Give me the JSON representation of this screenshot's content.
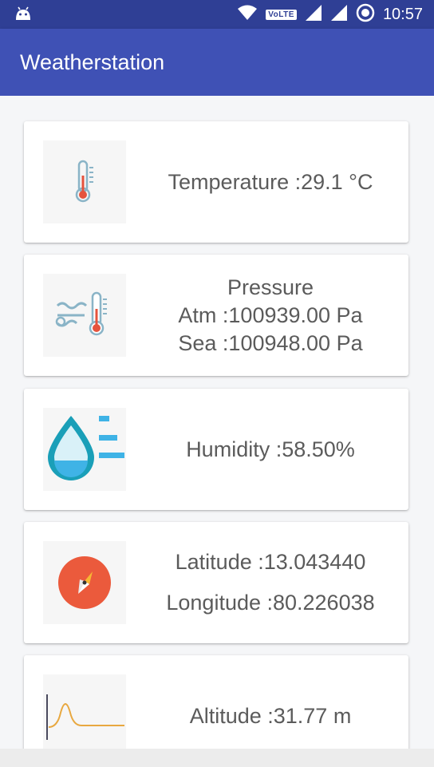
{
  "status_bar": {
    "time": "10:57",
    "network_badge": "VoLTE",
    "icons": [
      "android-icon",
      "wifi-icon",
      "signal-icon",
      "signal-icon",
      "sync-icon"
    ]
  },
  "app_bar": {
    "title": "Weatherstation",
    "color": "#3f51b5"
  },
  "cards": {
    "temperature": {
      "icon": "thermometer-icon",
      "text": "Temperature :29.1 °C"
    },
    "pressure": {
      "icon": "pressure-thermometer-icon",
      "title": "Pressure",
      "atm": "Atm :100939.00 Pa",
      "sea": "Sea :100948.00 Pa"
    },
    "humidity": {
      "icon": "water-drop-icon",
      "text": "Humidity :58.50%"
    },
    "location": {
      "icon": "compass-icon",
      "latitude": "Latitude :13.043440",
      "longitude": "Longitude :80.226038"
    },
    "altitude": {
      "icon": "altitude-graph-icon",
      "text": "Altitude :31.77 m"
    }
  }
}
